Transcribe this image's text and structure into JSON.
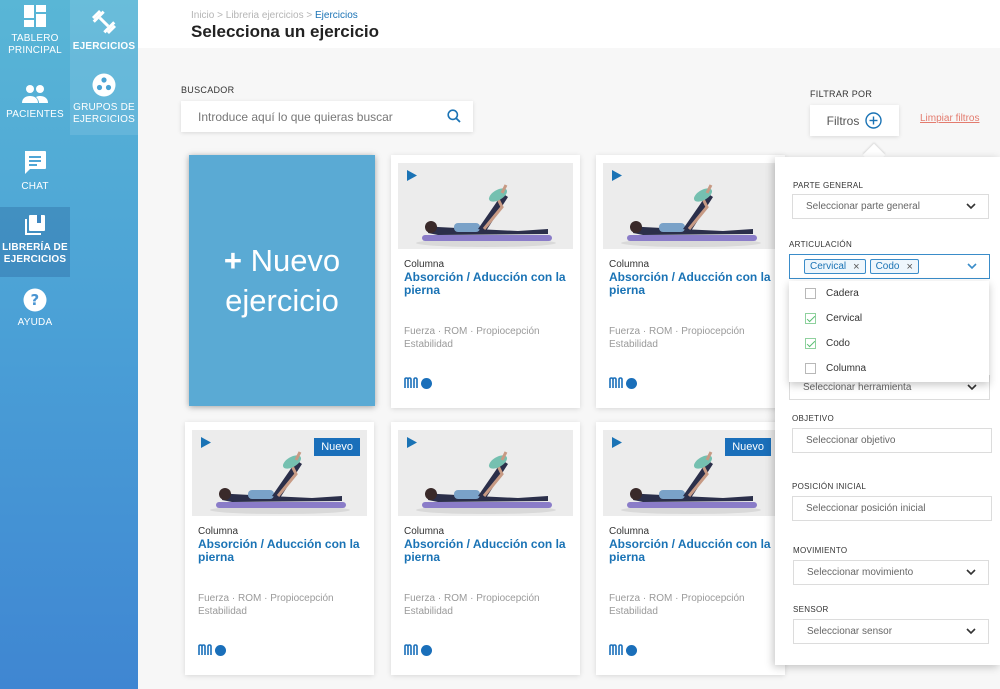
{
  "nav": {
    "tablero": "TABLERO PRINCIPAL",
    "pacientes": "PACIENTES",
    "chat": "CHAT",
    "libreria": "LIBRERÍA DE EJERCICIOS",
    "ayuda": "AYUDA",
    "ejercicios": "EJERCICIOS",
    "grupos": "GRUPOS DE EJERCICIOS"
  },
  "breadcrumb": {
    "inicio": "Inicio",
    "libreria": "Libreria ejercicios",
    "sep": ">",
    "current": "Ejercicios"
  },
  "page_title": "Selecciona un ejercicio",
  "search": {
    "label": "BUSCADOR",
    "placeholder": "Introduce aquí lo que quieras buscar"
  },
  "filter": {
    "label": "FILTRAR POR",
    "button": "Filtros",
    "clear": "Limpiar filtros"
  },
  "new_card": {
    "plus": "+",
    "line1": "Nuevo",
    "line2": "ejercicio"
  },
  "cards": [
    {
      "category": "Columna",
      "name": "Absorción / Aducción con la pierna",
      "tags1": "Fuerza · ROM  · Propiocepción",
      "tags2": "Estabilidad",
      "badge": ""
    },
    {
      "category": "Columna",
      "name": "Absorción / Aducción con la pierna",
      "tags1": "Fuerza · ROM  · Propiocepción",
      "tags2": "Estabilidad",
      "badge": ""
    },
    {
      "category": "Columna",
      "name": "Absorción / Aducción con la pierna",
      "tags1": "Fuerza · ROM  · Propiocepción",
      "tags2": "Estabilidad",
      "badge": "Nuevo"
    },
    {
      "category": "Columna",
      "name": "Absorción / Aducción con la pierna",
      "tags1": "Fuerza · ROM  · Propiocepción",
      "tags2": "Estabilidad",
      "badge": ""
    },
    {
      "category": "Columna",
      "name": "Absorción / Aducción con la pierna",
      "tags1": "Fuerza · ROM  · Propiocepción",
      "tags2": "Estabilidad",
      "badge": "Nuevo"
    }
  ],
  "panel": {
    "parte_general": {
      "label": "PARTE GENERAL",
      "placeholder": "Seleccionar parte general"
    },
    "articulacion": {
      "label": "ARTICULACIÓN",
      "chips": [
        "Cervical",
        "Codo"
      ]
    },
    "articulacion_options": [
      {
        "label": "Cadera",
        "checked": false
      },
      {
        "label": "Cervical",
        "checked": true
      },
      {
        "label": "Codo",
        "checked": true
      },
      {
        "label": "Columna",
        "checked": false
      }
    ],
    "herramienta": {
      "placeholder": "Seleccionar herramienta"
    },
    "objetivo": {
      "label": "OBJETIVO",
      "placeholder": "Seleccionar objetivo"
    },
    "posicion": {
      "label": "POSICIÓN INICIAL",
      "placeholder": "Seleccionar posición inicial"
    },
    "movimiento": {
      "label": "MOVIMIENTO",
      "placeholder": "Seleccionar movimiento"
    },
    "sensor": {
      "label": "SENSOR",
      "placeholder": "Seleccionar sensor"
    }
  },
  "colors": {
    "accent": "#1a73b5",
    "sidebar_top": "#59b6d6",
    "sidebar_bottom": "#3f86d2",
    "new_card": "#5aaad4",
    "clear_link": "#e37b6e",
    "check": "#5bbf73"
  }
}
